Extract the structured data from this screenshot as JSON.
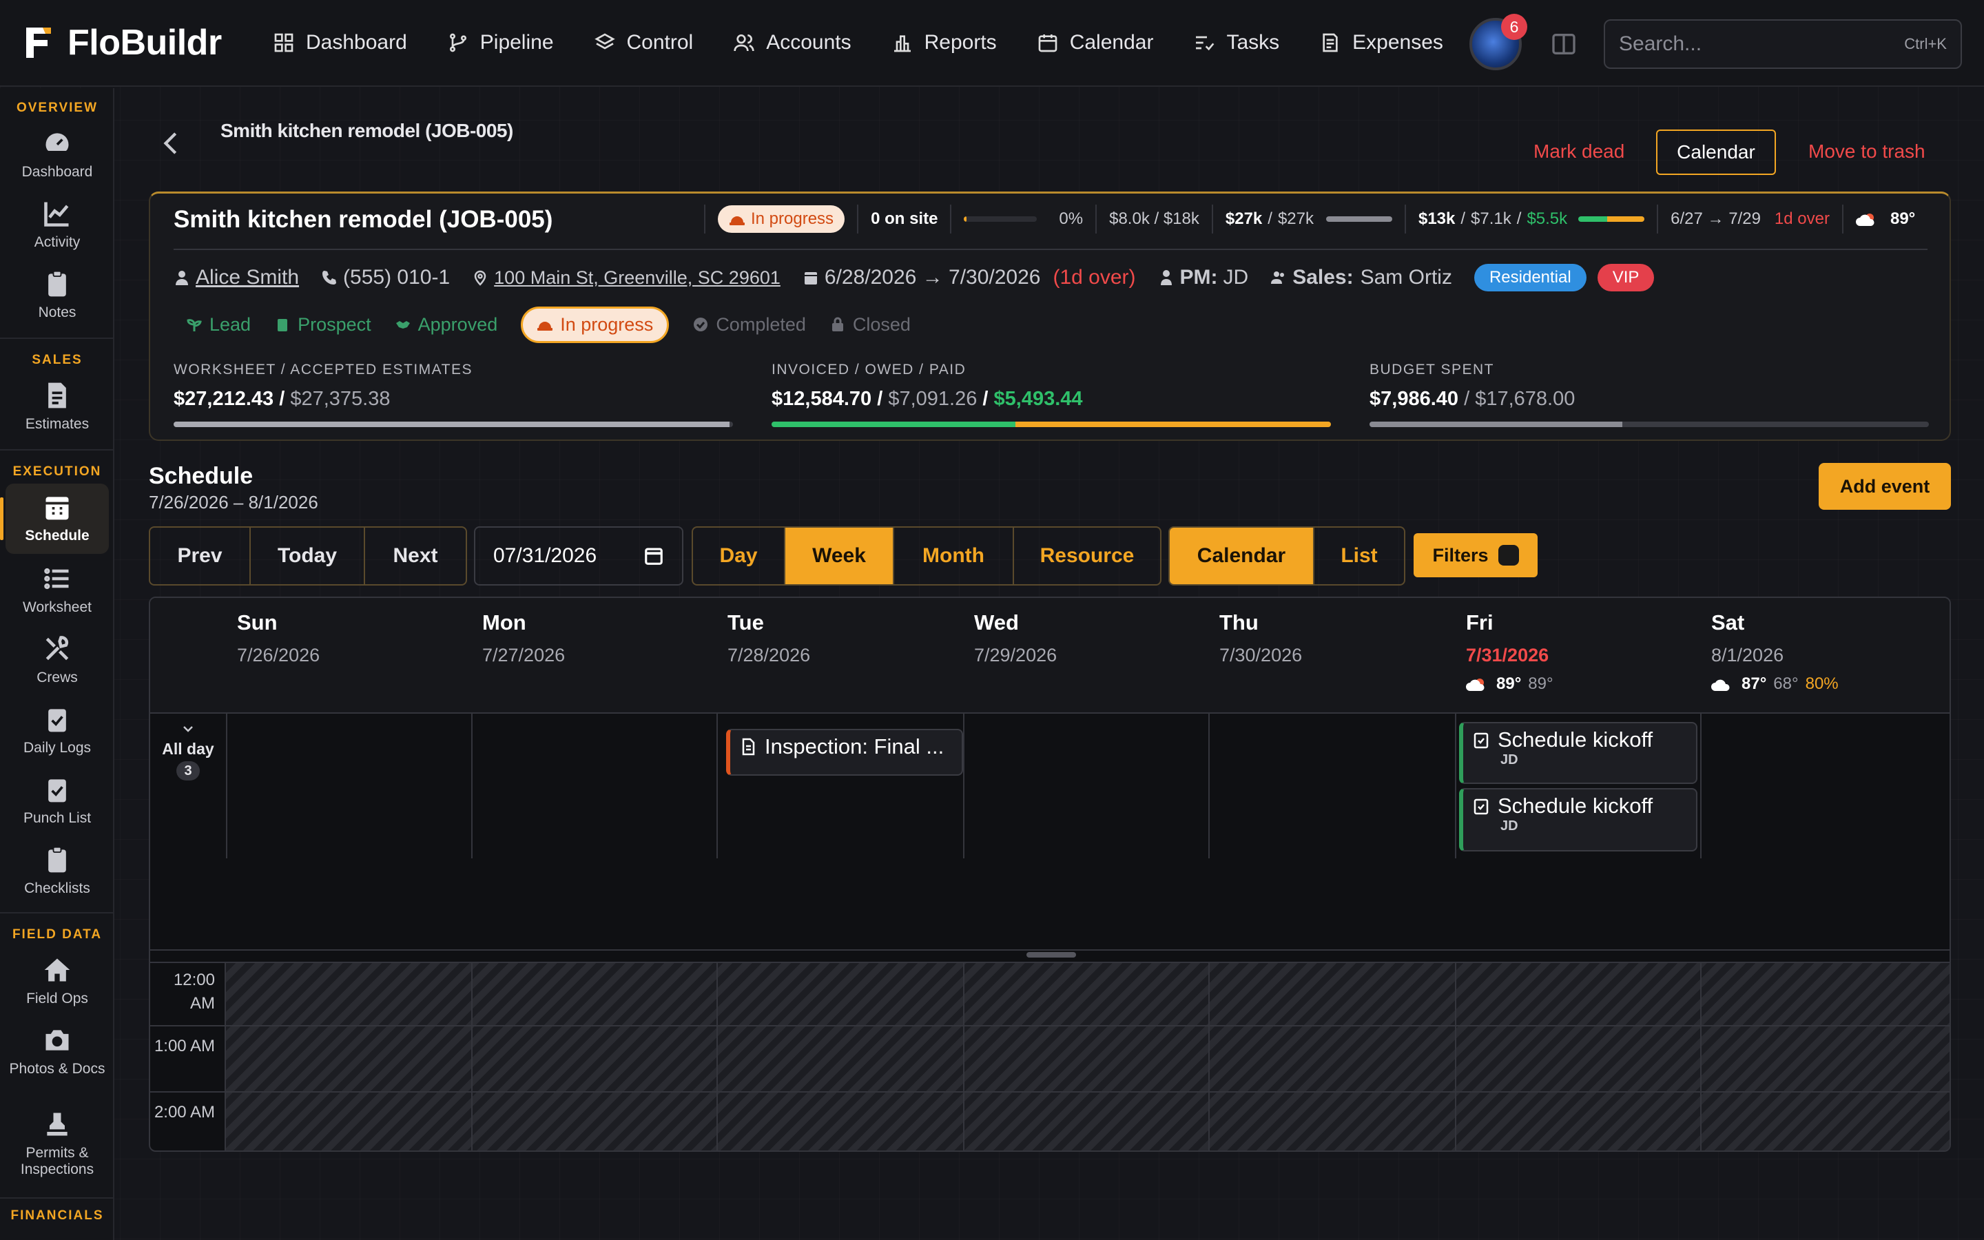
{
  "app": {
    "name": "FloBuildr"
  },
  "nav": [
    {
      "label": "Dashboard",
      "icon": "grid-icon"
    },
    {
      "label": "Pipeline",
      "icon": "branch-icon"
    },
    {
      "label": "Control",
      "icon": "layers-icon"
    },
    {
      "label": "Accounts",
      "icon": "users-icon"
    },
    {
      "label": "Reports",
      "icon": "bar-chart-icon"
    },
    {
      "label": "Calendar",
      "icon": "calendar-icon"
    },
    {
      "label": "Tasks",
      "icon": "checklist-icon"
    },
    {
      "label": "Expenses",
      "icon": "receipt-icon"
    }
  ],
  "user": {
    "notifications": "6"
  },
  "search": {
    "placeholder": "Search...",
    "shortcut": "Ctrl+K"
  },
  "sidebar": {
    "sections": {
      "overview": "OVERVIEW",
      "sales": "SALES",
      "execution": "EXECUTION",
      "field_data": "FIELD DATA",
      "financials": "FINANCIALS"
    },
    "items": {
      "dashboard": "Dashboard",
      "activity": "Activity",
      "notes": "Notes",
      "estimates": "Estimates",
      "schedule": "Schedule",
      "worksheet": "Worksheet",
      "crews": "Crews",
      "daily_logs": "Daily Logs",
      "punch_list": "Punch List",
      "checklists": "Checklists",
      "field_ops": "Field Ops",
      "photos_docs": "Photos & Docs",
      "permits": "Permits & Inspections"
    }
  },
  "header": {
    "breadcrumb": "Smith kitchen remodel (JOB-005)",
    "mark_dead": "Mark dead",
    "calendar": "Calendar",
    "trash": "Move to trash"
  },
  "job": {
    "title": "Smith kitchen remodel (JOB-005)",
    "status": "In progress",
    "on_site": "0 on site",
    "progress_pct": "0%",
    "progress_value": 0.03,
    "budget_short": "$8.0k / $18k",
    "est_a": "$27k",
    "est_sep": "/",
    "est_b": "$27k",
    "inv_a": "$13k",
    "inv_b": "$7.1k",
    "inv_c": "$5.5k",
    "dates_short": "6/27 → 7/29",
    "over_short": "1d over",
    "temp": "89°",
    "client": "Alice Smith",
    "phone": "(555) 010-1",
    "address": "100 Main St, Greenville, SC 29601",
    "date_range": "6/28/2026 → 7/30/2026",
    "over": "(1d over)",
    "pm_label": "PM:",
    "pm": "JD",
    "sales_label": "Sales:",
    "sales": "Sam Ortiz",
    "tags": [
      {
        "label": "Residential",
        "color": "#2f8fe0"
      },
      {
        "label": "VIP",
        "color": "#e4404b"
      }
    ],
    "stages": [
      "Lead",
      "Prospect",
      "Approved",
      "In progress",
      "Completed",
      "Closed"
    ],
    "fin": {
      "ws_label": "WORKSHEET / ACCEPTED ESTIMATES",
      "ws_a": "$27,212.43",
      "ws_sep": " / ",
      "ws_b": "$27,375.38",
      "ws_fill": 0.994,
      "inv_label": "INVOICED / OWED / PAID",
      "inv_a": "$12,584.70",
      "inv_s1": " / ",
      "inv_b": "$7,091.26",
      "inv_s2": " / ",
      "inv_c": "$5,493.44",
      "inv_paid_frac": 0.436,
      "bud_label": "BUDGET SPENT",
      "bud_a": "$7,986.40",
      "bud_sep": " / ",
      "bud_b": "$17,678.00",
      "bud_fill": 0.452
    }
  },
  "schedule": {
    "title": "Schedule",
    "range": "7/26/2026 – 8/1/2026",
    "add": "Add event",
    "nav": [
      "Prev",
      "Today",
      "Next"
    ],
    "date": "07/31/2026",
    "views": [
      "Day",
      "Week",
      "Month",
      "Resource"
    ],
    "active_view": "Week",
    "modes": [
      "Calendar",
      "List"
    ],
    "active_mode": "Calendar",
    "filters": "Filters",
    "all_day": "All day",
    "all_day_count": "3",
    "days": [
      {
        "name": "Sun",
        "date": "7/26/2026"
      },
      {
        "name": "Mon",
        "date": "7/27/2026"
      },
      {
        "name": "Tue",
        "date": "7/28/2026"
      },
      {
        "name": "Wed",
        "date": "7/29/2026"
      },
      {
        "name": "Thu",
        "date": "7/30/2026"
      },
      {
        "name": "Fri",
        "date": "7/31/2026",
        "hi": "89°",
        "lo": "89°"
      },
      {
        "name": "Sat",
        "date": "8/1/2026",
        "hi": "87°",
        "lo": "68°",
        "precip": "80%"
      }
    ],
    "events": [
      {
        "title": "Inspection: Final ...",
        "color": "#e0541e",
        "icon": "document-icon"
      },
      {
        "title": "Schedule kickoff",
        "sub": "JD",
        "color": "#2f9e5a",
        "icon": "task-icon"
      },
      {
        "title": "Schedule kickoff",
        "sub": "JD",
        "color": "#2f9e5a",
        "icon": "task-icon"
      }
    ],
    "times": [
      "12:00 AM",
      "1:00 AM",
      "2:00 AM"
    ]
  }
}
